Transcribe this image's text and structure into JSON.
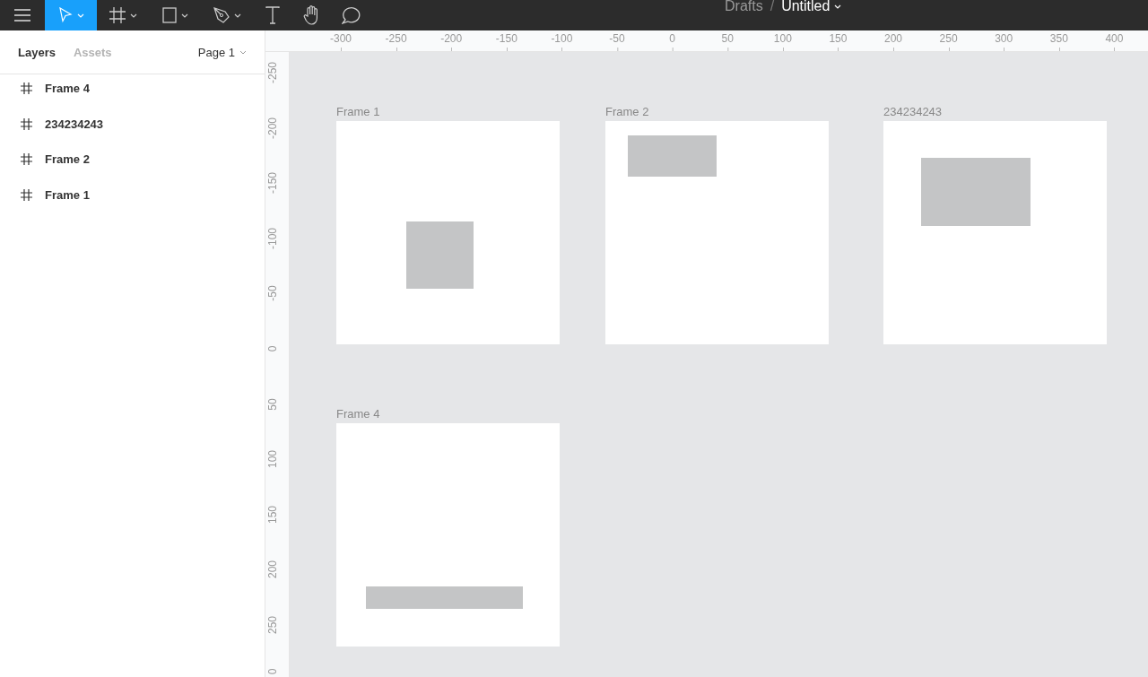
{
  "toolbar": {
    "tools": [
      {
        "kind": "menu",
        "selected": false,
        "dropdown": false
      },
      {
        "kind": "move",
        "selected": true,
        "dropdown": true
      },
      {
        "kind": "frame",
        "selected": false,
        "dropdown": true
      },
      {
        "kind": "shape",
        "selected": false,
        "dropdown": true
      },
      {
        "kind": "pen",
        "selected": false,
        "dropdown": true
      },
      {
        "kind": "text",
        "selected": false,
        "dropdown": false
      },
      {
        "kind": "hand",
        "selected": false,
        "dropdown": false
      },
      {
        "kind": "comment",
        "selected": false,
        "dropdown": false
      }
    ],
    "breadcrumb": {
      "folder": "Drafts",
      "separator": "/",
      "file": "Untitled"
    }
  },
  "sidebar": {
    "tabs": [
      {
        "label": "Layers",
        "selected": true
      },
      {
        "label": "Assets",
        "selected": false
      }
    ],
    "page": "Page 1",
    "layers": [
      {
        "label": "Frame 4"
      },
      {
        "label": "234234243"
      },
      {
        "label": "Frame 2"
      },
      {
        "label": "Frame 1"
      }
    ]
  },
  "rulers": {
    "horizontal": [
      "-300",
      "-250",
      "-200",
      "-150",
      "-100",
      "-50",
      "0",
      "50",
      "100",
      "150",
      "200",
      "250",
      "300",
      "350",
      "400"
    ],
    "vertical": [
      "-250",
      "-200",
      "-150",
      "-100",
      "-50",
      "0",
      "50",
      "100",
      "150",
      "200",
      "250",
      "0"
    ]
  },
  "canvas": {
    "frames": [
      {
        "label": "Frame 1"
      },
      {
        "label": "Frame 2"
      },
      {
        "label": "234234243"
      },
      {
        "label": "Frame 4"
      }
    ]
  }
}
